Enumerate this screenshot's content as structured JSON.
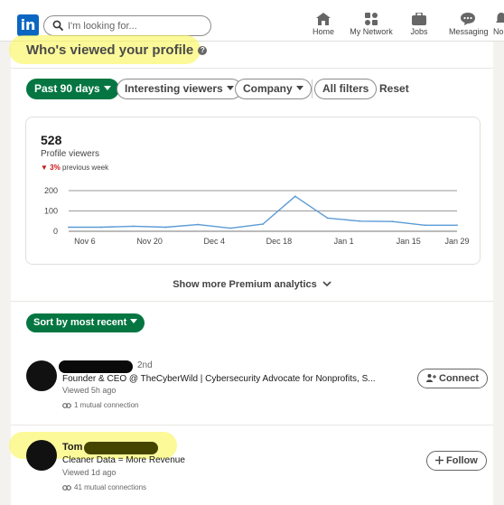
{
  "nav": {
    "logo_text": "in",
    "search_placeholder": "I'm looking for...",
    "items": [
      {
        "label": "Home",
        "icon": "home-icon"
      },
      {
        "label": "My Network",
        "icon": "network-icon"
      },
      {
        "label": "Jobs",
        "icon": "briefcase-icon"
      },
      {
        "label": "Messaging",
        "icon": "messaging-icon"
      },
      {
        "label": "No",
        "icon": "bell-icon"
      }
    ]
  },
  "page": {
    "title": "Who's viewed your profile",
    "help_icon": "?"
  },
  "filters": {
    "past": "Past 90 days",
    "interesting": "Interesting viewers",
    "company": "Company",
    "all": "All filters",
    "reset": "Reset"
  },
  "stats": {
    "count": "528",
    "label": "Profile viewers",
    "delta_arrow": "▼",
    "delta_value": "3%",
    "delta_text": "previous week"
  },
  "chart_data": {
    "type": "line",
    "title": "",
    "xlabel": "",
    "ylabel": "",
    "x": [
      "Nov 3",
      "Nov 10",
      "Nov 17",
      "Nov 24",
      "Dec 1",
      "Dec 8",
      "Dec 15",
      "Dec 22",
      "Dec 29",
      "Jan 5",
      "Jan 12",
      "Jan 19",
      "Jan 26"
    ],
    "series": [
      {
        "values": [
          20,
          20,
          25,
          20,
          33,
          15,
          35,
          172,
          65,
          50,
          48,
          30,
          30
        ]
      }
    ],
    "xticks": [
      "Nov 6",
      "Nov 20",
      "Dec 4",
      "Dec 18",
      "Jan 1",
      "Jan 15",
      "Jan 29"
    ],
    "yticks": [
      0,
      100,
      200
    ],
    "ylim": [
      0,
      200
    ],
    "grid": true,
    "line_color": "#5b9bd5"
  },
  "analytics_link": "Show more Premium analytics",
  "sort_label": "Sort by most recent",
  "viewers": [
    {
      "degree": "2nd",
      "headline": "Founder & CEO @ TheCyberWild | Cybersecurity Advocate for Nonprofits, S...",
      "viewed": "Viewed 5h ago",
      "connections": "1 mutual connection",
      "action": "Connect"
    },
    {
      "name": "Tom",
      "headline": "Cleaner Data = More Revenue",
      "viewed": "Viewed 1d ago",
      "connections": "41 mutual connections",
      "action": "Follow"
    }
  ],
  "colors": {
    "accent_green": "#057642",
    "brand_blue": "#0a66c2",
    "highlight": "#f7f35a",
    "decline_red": "#cc1016"
  }
}
